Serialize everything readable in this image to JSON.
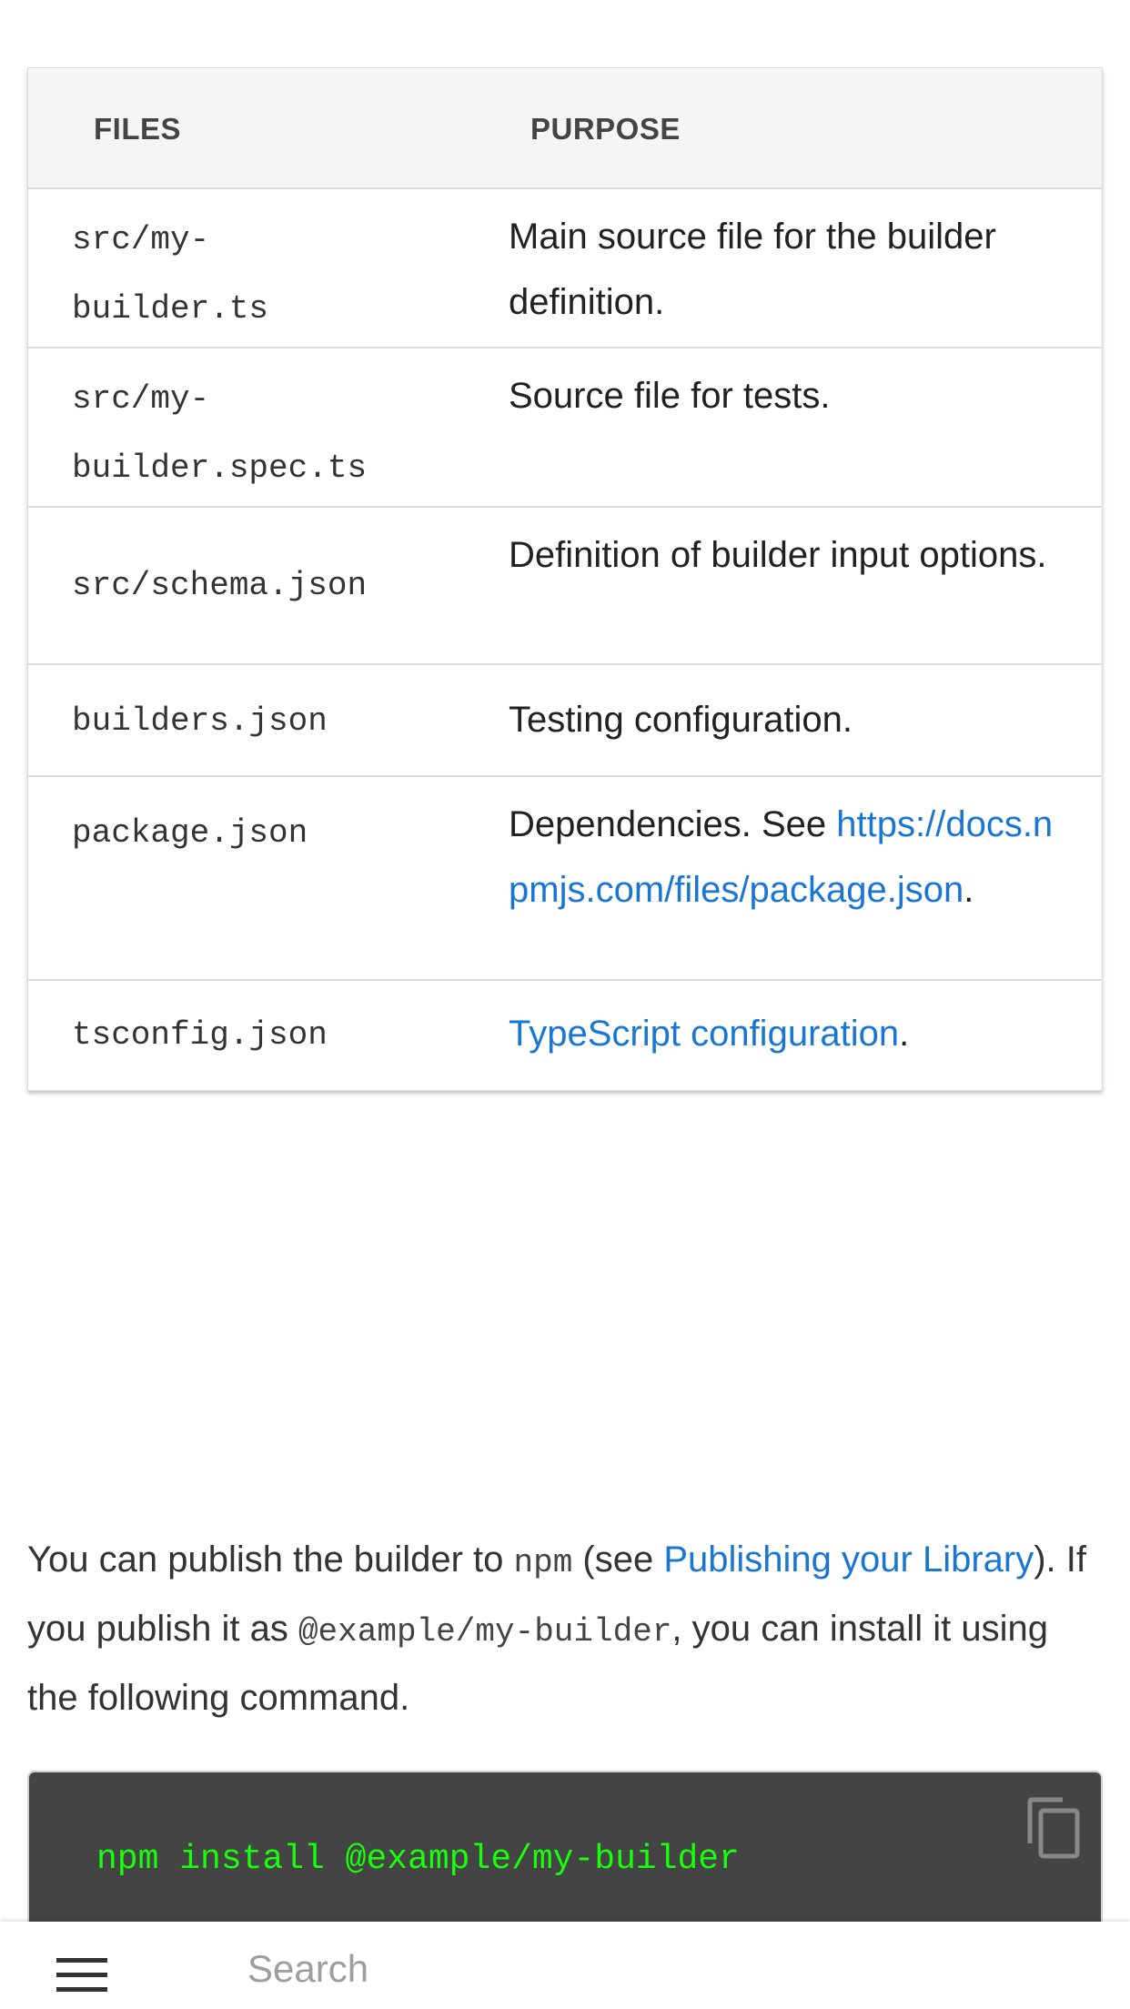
{
  "table": {
    "headers": {
      "files": "FILES",
      "purpose": "PURPOSE"
    },
    "rows": [
      {
        "file": "src/my-builder.ts",
        "purpose": "Main source file for the builder definition."
      },
      {
        "file": "src/my-builder.spec.ts",
        "purpose": "Source file for tests."
      },
      {
        "file": "src/schema.json",
        "purpose": "Definition of builder input options."
      },
      {
        "file": "builders.json",
        "purpose": "Testing configuration."
      },
      {
        "file": "package.json",
        "purpose_prefix": "Dependencies. See ",
        "purpose_link": "https://docs.npmjs.com/files/package.json",
        "purpose_suffix": "."
      },
      {
        "file": "tsconfig.json",
        "purpose_link": "TypeScript configuration",
        "purpose_suffix": "."
      }
    ]
  },
  "paragraph": {
    "t1": "You can publish the builder to ",
    "code1": "npm",
    "t2": " (see ",
    "link": "Publishing your Library",
    "t3": "). If you publish it as ",
    "code2": "@example/my-builder",
    "t4": ", you can install it using the following command."
  },
  "code_block": {
    "command": "npm install @example/my-builder",
    "copy_icon": "copy-icon",
    "text_color": "#17ff0b",
    "background": "#444444"
  },
  "bottom_bar": {
    "menu_icon": "hamburger-menu-icon",
    "search_placeholder": "Search"
  },
  "colors": {
    "link": "#1976d2",
    "header_bg": "#f5f5f5"
  }
}
